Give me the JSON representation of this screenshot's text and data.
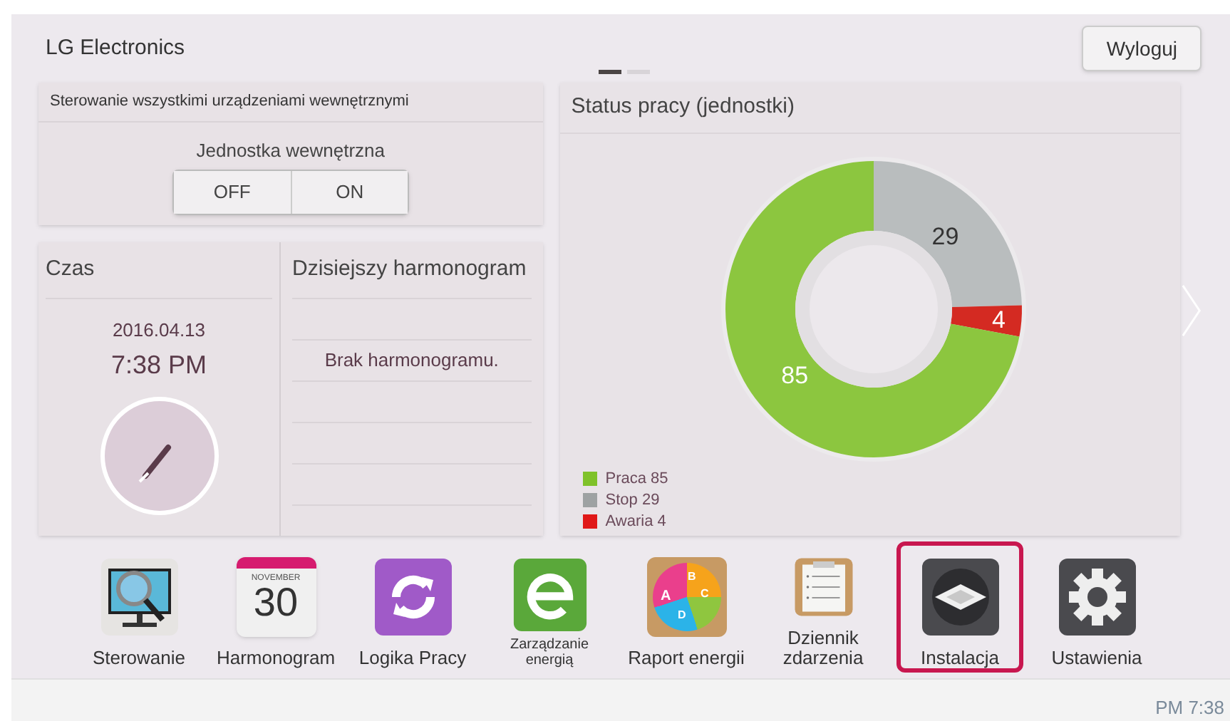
{
  "header": {
    "title": "LG Electronics",
    "logout": "Wyloguj"
  },
  "pages": [
    {
      "selected": true
    },
    {
      "selected": false
    }
  ],
  "control_all": {
    "title": "Sterowanie wszystkimi urządzeniami wewnętrznymi",
    "label": "Jednostka wewnętrzna",
    "buttons": [
      "OFF",
      "ON"
    ]
  },
  "time": {
    "title": "Czas",
    "date": "2016.04.13",
    "time": "7:38 PM"
  },
  "schedule": {
    "title": "Dzisiejszy harmonogram",
    "empty": "Brak harmonogramu."
  },
  "status": {
    "title": "Status pracy (jednostki)",
    "chart_data": {
      "type": "donut",
      "series": [
        {
          "values": [
            29,
            4,
            85
          ]
        }
      ],
      "colors": [
        "#b9bdbe",
        "#d42a22",
        "#8cc63f"
      ],
      "data_labels": true
    },
    "legend": [
      {
        "label": "Praca 85",
        "color": "#7fc22a"
      },
      {
        "label": "Stop 29",
        "color": "#9ea2a3"
      },
      {
        "label": "Awaria 4",
        "color": "#e01818"
      }
    ]
  },
  "dock": [
    {
      "kind": "monitor",
      "label": "Sterowanie",
      "selected": false
    },
    {
      "kind": "calendar",
      "label": "Harmonogram",
      "icon_text": [
        "NOVEMBER",
        "30"
      ],
      "selected": false
    },
    {
      "kind": "cycle",
      "label": "Logika Pracy",
      "selected": false
    },
    {
      "kind": "energy",
      "label": "Zarządzanie energią",
      "small": true,
      "selected": false
    },
    {
      "kind": "pie",
      "label": "Raport energii",
      "icon_text": [
        "A",
        "B",
        "C",
        "D"
      ],
      "selected": false
    },
    {
      "kind": "clipboard",
      "label": "Dziennik zdarzenia",
      "selected": false
    },
    {
      "kind": "cassette",
      "label": "Instalacja",
      "selected": true
    },
    {
      "kind": "gear",
      "label": "Ustawienia",
      "selected": false
    }
  ],
  "status_bar": {
    "time": "PM 7:38"
  }
}
